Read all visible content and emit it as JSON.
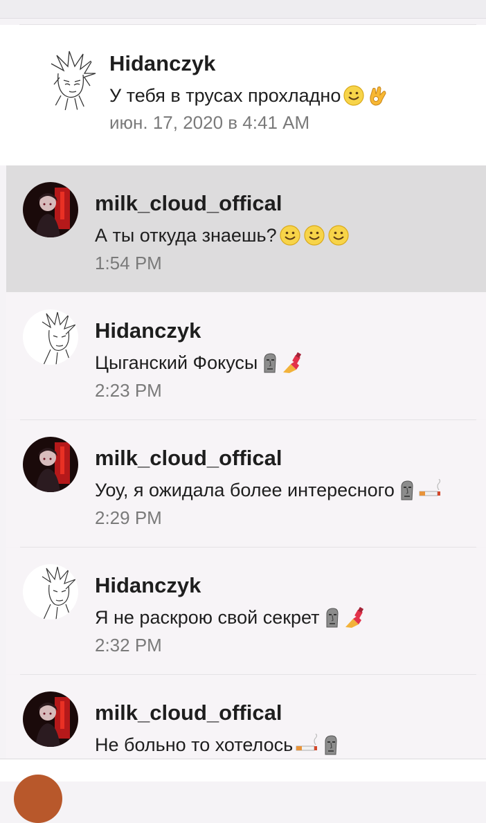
{
  "messages": [
    {
      "author": "Hidanczyk",
      "text": "У тебя в трусах прохладно",
      "emojis": [
        "smile-emoji",
        "ok-hand-emoji"
      ],
      "time": "июн. 17, 2020 в 4:41 AM",
      "avatar": "sketch-avatar"
    },
    {
      "author": "milk_cloud_offical",
      "text": "А ты откуда знаешь? ",
      "emojis": [
        "smile-emoji",
        "smile-emoji",
        "smile-emoji"
      ],
      "time": "1:54 PM",
      "avatar": "dark-red-avatar",
      "selected": true
    },
    {
      "author": "Hidanczyk",
      "text": "Цыганский Фокусы",
      "emojis": [
        "moai-emoji",
        "nail-polish-emoji"
      ],
      "time": "2:23 PM",
      "avatar": "sketch-avatar"
    },
    {
      "author": "milk_cloud_offical",
      "text": "Уоу, я ожидала более интересного ",
      "emojis": [
        "moai-emoji",
        "cigarette-emoji"
      ],
      "time": "2:29 PM",
      "avatar": "dark-red-avatar"
    },
    {
      "author": "Hidanczyk",
      "text": "Я не раскрою свой секрет",
      "emojis": [
        "moai-emoji",
        "nail-polish-emoji"
      ],
      "time": "2:32 PM",
      "avatar": "sketch-avatar"
    },
    {
      "author": "milk_cloud_offical",
      "text": "Не больно то хотелось ",
      "emojis": [
        "cigarette-emoji",
        "moai-emoji"
      ],
      "time": "",
      "avatar": "dark-red-avatar"
    }
  ],
  "colors": {
    "background": "#f5f3f6",
    "selected_row": "#dddcdd",
    "text": "#1e1e1e",
    "timestamp": "#7a7a7a"
  }
}
